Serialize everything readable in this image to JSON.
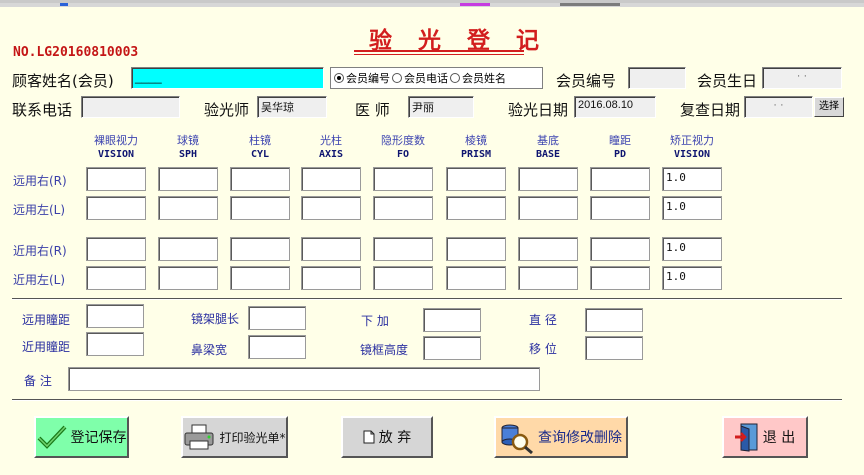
{
  "form": {
    "title": "验 光 登 记",
    "record_no": "NO.LG20160810003"
  },
  "header": {
    "customer_name_label": "顾客姓名(会员)",
    "customer_name_value": "____",
    "search_mode_options": [
      "会员编号",
      "会员电话",
      "会员姓名"
    ],
    "search_mode_selected": "会员编号",
    "member_no_label": "会员编号",
    "member_no_value": "",
    "birthday_label": "会员生日",
    "birthday_value": "·  ·",
    "phone_label": "联系电话",
    "phone_value": "",
    "optometrist_label": "验光师",
    "optometrist_value": "吴华琼",
    "doctor_label": "医  师",
    "doctor_value": "尹丽",
    "exam_date_label": "验光日期",
    "exam_date_value": "2016.08.10",
    "recheck_date_label": "复查日期",
    "recheck_date_value": "·  ·",
    "select_button_label": "选择"
  },
  "grid": {
    "columns": [
      {
        "cn": "裸眼视力",
        "en": "VISION"
      },
      {
        "cn": "球镜",
        "en": "SPH"
      },
      {
        "cn": "柱镜",
        "en": "CYL"
      },
      {
        "cn": "光柱",
        "en": "AXIS"
      },
      {
        "cn": "隐形度数",
        "en": "FO"
      },
      {
        "cn": "棱镜",
        "en": "PRISM"
      },
      {
        "cn": "基底",
        "en": "BASE"
      },
      {
        "cn": "瞳距",
        "en": "PD"
      },
      {
        "cn": "矫正视力",
        "en": "VISION"
      }
    ],
    "rows": [
      {
        "label": "远用右(R)",
        "corrected_vision": "1.0"
      },
      {
        "label": "远用左(L)",
        "corrected_vision": "1.0"
      },
      {
        "label": "近用右(R)",
        "corrected_vision": "1.0"
      },
      {
        "label": "近用左(L)",
        "corrected_vision": "1.0"
      }
    ]
  },
  "extras": {
    "far_pd_label": "远用瞳距",
    "near_pd_label": "近用瞳距",
    "temple_len_label": "镜架腿长",
    "bridge_width_label": "鼻梁宽",
    "add_label": "下  加",
    "frame_height_label": "镜框高度",
    "diameter_label": "直  径",
    "shift_label": "移  位",
    "notes_label": "备  注"
  },
  "buttons": {
    "save": "登记保存",
    "print": "打印验光单*",
    "discard": "放 弃",
    "query": "查询修改删除",
    "exit": "退 出"
  },
  "colors": {
    "background": "#ffffe8",
    "title_red": "#d21e1e",
    "name_field_highlight": "#00ffff",
    "save_button": "#7fffaa",
    "query_button": "#ffd9a8",
    "exit_button": "#ffc8c8"
  }
}
